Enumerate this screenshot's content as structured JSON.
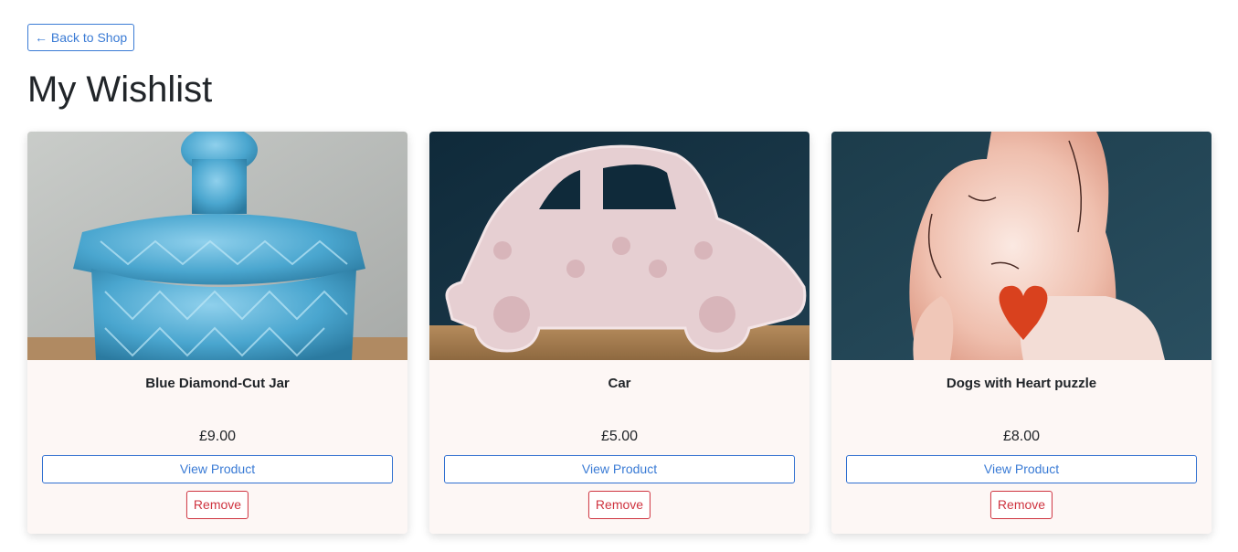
{
  "nav": {
    "back_label": "← Back to Shop"
  },
  "page": {
    "title": "My Wishlist"
  },
  "wishlist": {
    "items": [
      {
        "name": "Blue Diamond-Cut Jar",
        "price": "£9.00",
        "view_label": "View Product",
        "remove_label": "Remove"
      },
      {
        "name": "Car",
        "price": "£5.00",
        "view_label": "View Product",
        "remove_label": "Remove"
      },
      {
        "name": "Dogs with Heart puzzle",
        "price": "£8.00",
        "view_label": "View Product",
        "remove_label": "Remove"
      }
    ]
  },
  "colors": {
    "accent": "#3a7bd5",
    "danger": "#cf3440",
    "card_background": "#fdf7f5"
  }
}
